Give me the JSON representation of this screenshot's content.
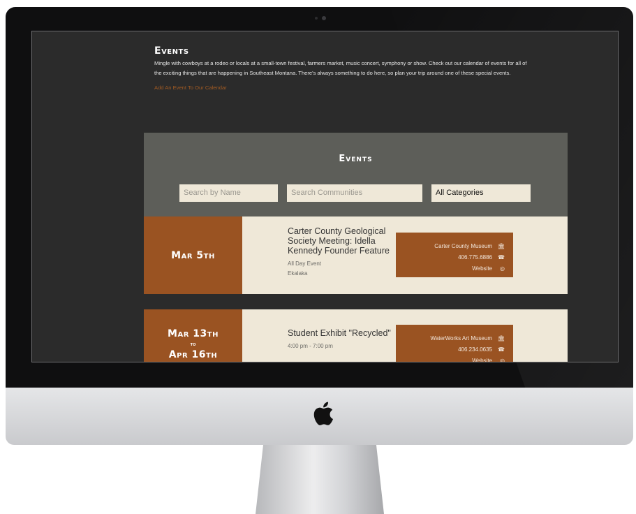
{
  "intro": {
    "title": "Events",
    "text": "Mingle with cowboys at a rodeo or locals at a small-town festival, farmers market, music concert, symphony or show. Check out our calendar of events for all of the exciting things that are happening in Southeast Montana. There's always something to do here, so plan your trip around one of these special events.",
    "link": "Add An Event To Our Calendar"
  },
  "panel": {
    "heading": "Events",
    "search_name_placeholder": "Search by Name",
    "search_communities_placeholder": "Search Communities",
    "category_value": "All Categories"
  },
  "events": [
    {
      "date": "Mar 5th",
      "title": "Carter County Geological Society Meeting: Idella Kennedy Founder Feature",
      "time": "All Day Event",
      "location": "Ekalaka",
      "venue": "Carter County Museum",
      "phone": "406.775.6886",
      "website": "Website"
    },
    {
      "date_start": "Mar 13th",
      "date_sep": "to",
      "date_end": "Apr 16th",
      "title": "Student Exhibit \"Recycled\"",
      "time": "4:00 pm - 7:00 pm",
      "venue": "WaterWorks Art Museum",
      "phone": "406.234.0635",
      "website": "Website"
    }
  ],
  "icons": {
    "venue": "building-icon",
    "phone": "phone-icon",
    "website": "globe-icon",
    "brand": "apple-logo"
  },
  "colors": {
    "accent": "#9a5322",
    "card_bg": "#efe8d8",
    "panel_bg": "#5d5e59",
    "page_bg": "#2b2b2b"
  }
}
